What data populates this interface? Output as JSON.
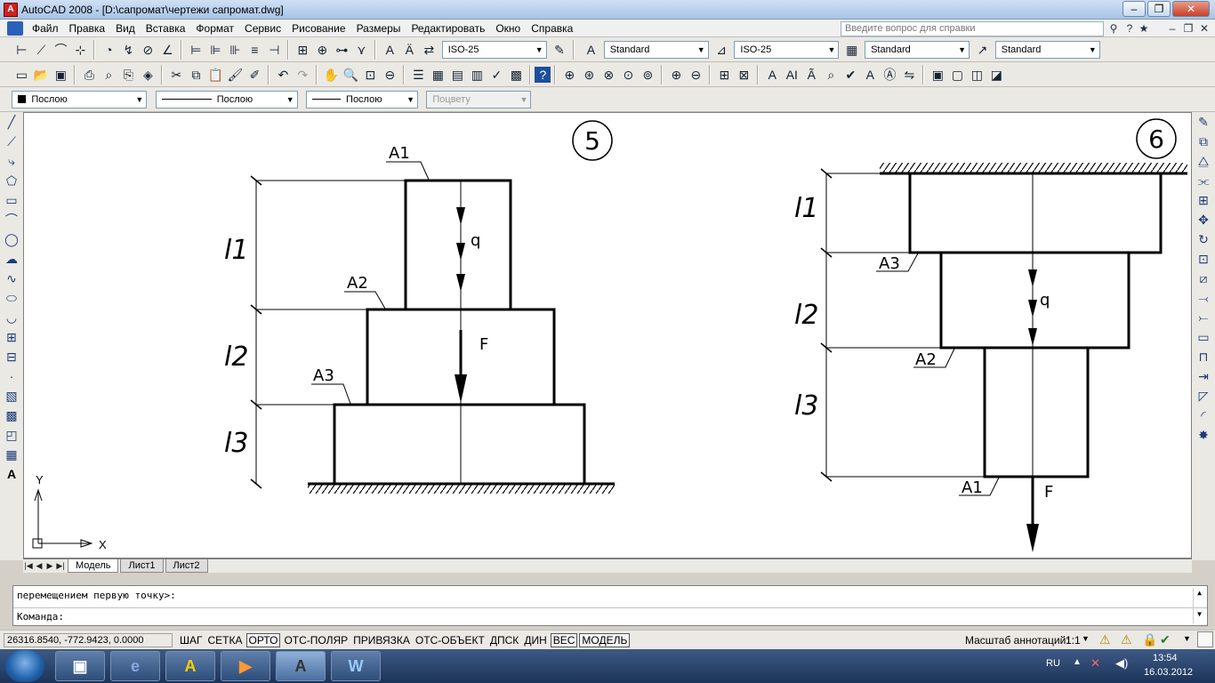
{
  "window": {
    "title": "AutoCAD 2008 - [D:\\сапромат\\чертежи сапромат.dwg]",
    "app_icon_letter": "A",
    "minimize": "–",
    "restore": "❐",
    "close": "✕"
  },
  "menu": {
    "items": [
      "Файл",
      "Правка",
      "Вид",
      "Вставка",
      "Формат",
      "Сервис",
      "Рисование",
      "Размеры",
      "Редактировать",
      "Окно",
      "Справка"
    ],
    "help_placeholder": "Введите вопрос для справки"
  },
  "toolbar_styles": {
    "dim_style": "ISO-25",
    "text_style": "Standard",
    "dim_style2": "ISO-25",
    "table_style": "Standard",
    "multileader_style": "Standard"
  },
  "toolbar_props": {
    "color": "Послою",
    "linetype": "Послою",
    "lineweight": "Послою",
    "plotstyle": "Поцвету"
  },
  "drawing": {
    "fig5": {
      "number": "5",
      "labels": {
        "a1": "A1",
        "a2": "A2",
        "a3": "A3",
        "l1": "l1",
        "l2": "l2",
        "l3": "l3",
        "q": "q",
        "f": "F"
      }
    },
    "fig6": {
      "number": "6",
      "labels": {
        "a1": "A1",
        "a2": "A2",
        "a3": "A3",
        "l1": "l1",
        "l2": "l2",
        "l3": "l3",
        "q": "q",
        "f": "F"
      }
    },
    "ucs": {
      "x": "X",
      "y": "Y"
    }
  },
  "tabs": {
    "items": [
      "Модель",
      "Лист1",
      "Лист2"
    ],
    "active": "Модель"
  },
  "command": {
    "history": "перемещением первую точку>:",
    "prompt": "Команда:"
  },
  "status": {
    "coords": "26316.8540, -772.9423, 0.0000",
    "buttons": [
      {
        "label": "ШАГ",
        "on": false
      },
      {
        "label": "СЕТКА",
        "on": false
      },
      {
        "label": "ОРТО",
        "on": true
      },
      {
        "label": "ОТС-ПОЛЯР",
        "on": false
      },
      {
        "label": "ПРИВЯЗКА",
        "on": false
      },
      {
        "label": "ОТС-ОБЪЕКТ",
        "on": false
      },
      {
        "label": "ДПСК",
        "on": false
      },
      {
        "label": "ДИН",
        "on": false
      },
      {
        "label": "ВЕС",
        "on": true
      },
      {
        "label": "МОДЕЛЬ",
        "on": true
      }
    ],
    "annotation_scale_label": "Масштаб аннотаций:",
    "annotation_scale_value": "1:1"
  },
  "taskbar": {
    "lang": "RU",
    "time": "13:54",
    "date": "16.03.2012"
  }
}
